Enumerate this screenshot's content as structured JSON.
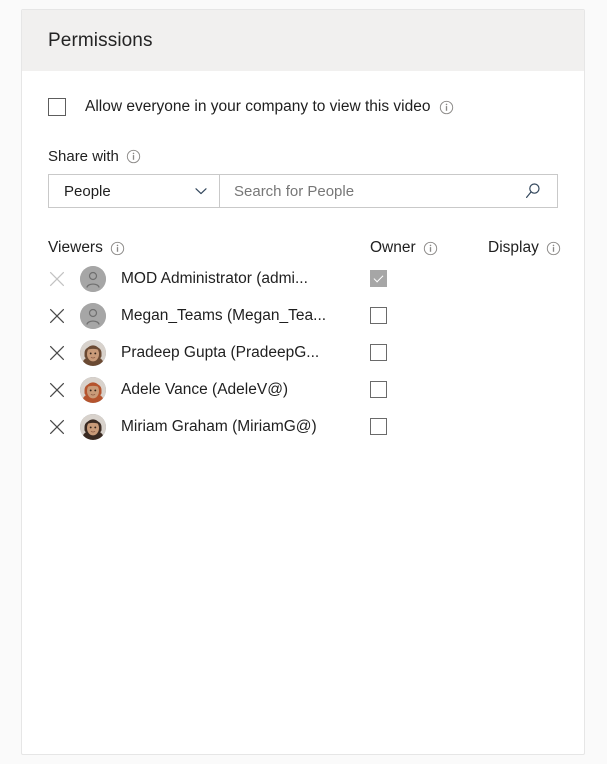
{
  "panel": {
    "title": "Permissions"
  },
  "allow_everyone": {
    "label": "Allow everyone in your company to view this video",
    "checked": false,
    "info_icon": "info-icon"
  },
  "share_with": {
    "label": "Share with",
    "info_icon": "info-icon",
    "select": {
      "value": "People",
      "options": [
        "People"
      ],
      "chevron_icon": "chevron-down-icon"
    },
    "search": {
      "value": "",
      "placeholder": "Search for People",
      "icon": "search-icon"
    }
  },
  "table": {
    "headers": {
      "viewers": "Viewers",
      "owner": "Owner",
      "display": "Display"
    },
    "rows": [
      {
        "name": "MOD Administrator (admi...",
        "avatar_type": "placeholder",
        "avatar_color": "#a6a6a6",
        "owner_checked": true,
        "owner_disabled": true,
        "remove_disabled": true,
        "remove_icon": "close-icon"
      },
      {
        "name": "Megan_Teams (Megan_Tea...",
        "avatar_type": "placeholder",
        "avatar_color": "#a6a6a6",
        "owner_checked": false,
        "owner_disabled": false,
        "remove_disabled": false,
        "remove_icon": "close-icon"
      },
      {
        "name": "Pradeep Gupta (PradeepG...",
        "avatar_type": "photo",
        "avatar_color": "#6b4a33",
        "owner_checked": false,
        "owner_disabled": false,
        "remove_disabled": false,
        "remove_icon": "close-icon"
      },
      {
        "name": "Adele Vance (AdeleV@)",
        "avatar_type": "photo",
        "avatar_color": "#b5542e",
        "owner_checked": false,
        "owner_disabled": false,
        "remove_disabled": false,
        "remove_icon": "close-icon"
      },
      {
        "name": "Miriam Graham (MiriamG@)",
        "avatar_type": "photo",
        "avatar_color": "#3a2a22",
        "owner_checked": false,
        "owner_disabled": false,
        "remove_disabled": false,
        "remove_icon": "close-icon"
      }
    ]
  },
  "colors": {
    "header_background": "#f1f0ef",
    "panel_background": "#ffffff",
    "page_background": "#fafafa",
    "border": "#e6e6e6",
    "text": "#1f1f1f",
    "muted_text": "#777777"
  }
}
